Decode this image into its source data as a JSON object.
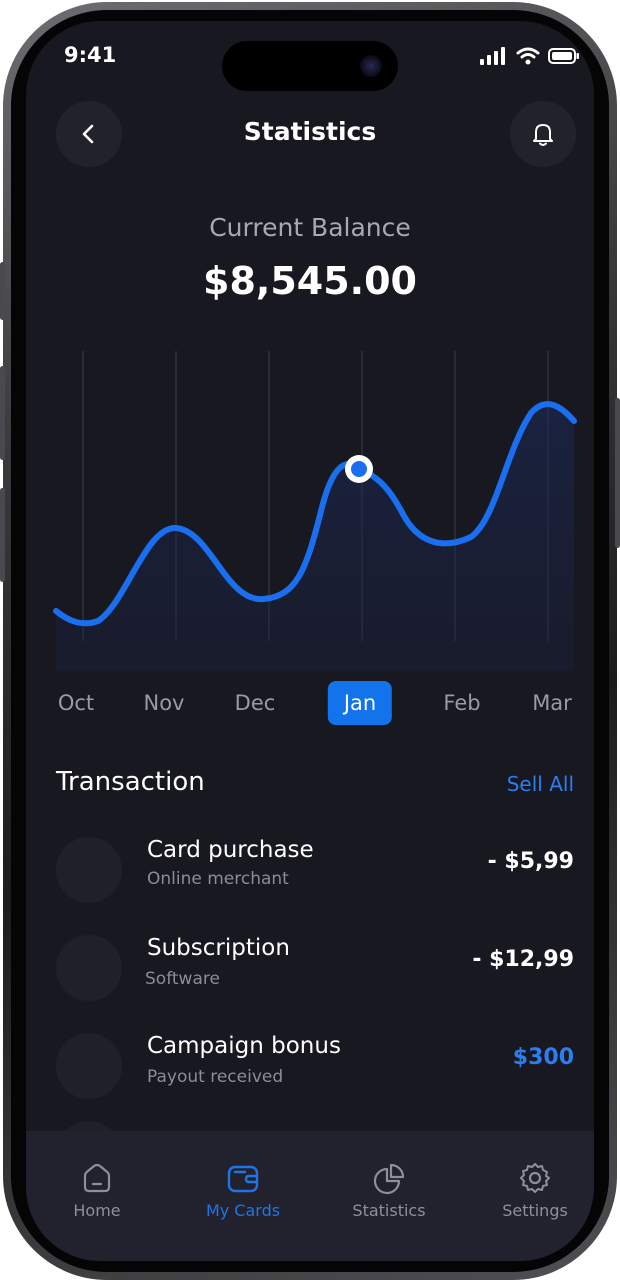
{
  "status_bar": {
    "time": "9:41"
  },
  "header": {
    "title": "Statistics",
    "back_icon": "chevron-left-icon",
    "notification_icon": "bell-icon"
  },
  "balance": {
    "label": "Current Balance",
    "value": "$8,545.00"
  },
  "chart_data": {
    "type": "line",
    "categories": [
      "Oct",
      "Nov",
      "Dec",
      "Jan",
      "Feb",
      "Mar"
    ],
    "selected": "Jan",
    "accent_color": "#1a6ff0",
    "grid": "vertical"
  },
  "months": [
    {
      "label": "Oct"
    },
    {
      "label": "Nov"
    },
    {
      "label": "Dec"
    },
    {
      "label": "Jan",
      "active": true
    },
    {
      "label": "Feb"
    },
    {
      "label": "Mar"
    }
  ],
  "transactions": {
    "title": "Transaction",
    "see_all": "Sell All",
    "items": [
      {
        "title": "Card purchase",
        "subtitle": "Online merchant",
        "amount": "- $5,99",
        "positive": false
      },
      {
        "title": "Subscription",
        "subtitle": "Software",
        "amount": "- $12,99",
        "positive": false
      },
      {
        "title": "Campaign bonus",
        "subtitle": "Payout received",
        "amount": "$300",
        "positive": true
      }
    ]
  },
  "nav": {
    "items": [
      {
        "label": "Home",
        "icon": "home-icon"
      },
      {
        "label": "My Cards",
        "icon": "wallet-icon",
        "active": true
      },
      {
        "label": "Statistics",
        "icon": "pie-chart-icon"
      },
      {
        "label": "Settings",
        "icon": "gear-icon"
      }
    ]
  },
  "colors": {
    "accent": "#1273ea",
    "background": "#181820",
    "surface": "#22222b"
  }
}
